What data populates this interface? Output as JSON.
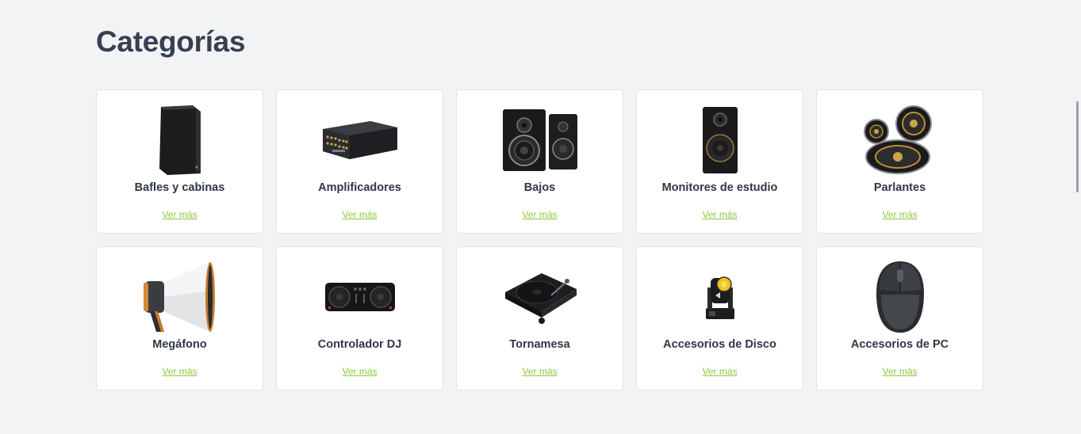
{
  "section": {
    "title": "Categorías"
  },
  "colors": {
    "accent": "#8cc63f",
    "title": "#364050",
    "card_bg": "#ffffff",
    "page_bg": "#f2f3f5"
  },
  "categories": [
    {
      "name": "Bafles y cabinas",
      "link": "Ver más",
      "icon": "speaker-cabinet-icon"
    },
    {
      "name": "Amplificadores",
      "link": "Ver más",
      "icon": "amplifier-icon"
    },
    {
      "name": "Bajos",
      "link": "Ver más",
      "icon": "bass-speakers-icon"
    },
    {
      "name": "Monitores de estudio",
      "link": "Ver más",
      "icon": "studio-monitor-icon"
    },
    {
      "name": "Parlantes",
      "link": "Ver más",
      "icon": "car-speakers-icon"
    },
    {
      "name": "Megáfono",
      "link": "Ver más",
      "icon": "megaphone-icon"
    },
    {
      "name": "Controlador DJ",
      "link": "Ver más",
      "icon": "dj-controller-icon"
    },
    {
      "name": "Tornamesa",
      "link": "Ver más",
      "icon": "turntable-icon"
    },
    {
      "name": "Accesorios de Disco",
      "link": "Ver más",
      "icon": "moving-head-light-icon"
    },
    {
      "name": "Accesorios de PC",
      "link": "Ver más",
      "icon": "computer-mouse-icon"
    }
  ]
}
